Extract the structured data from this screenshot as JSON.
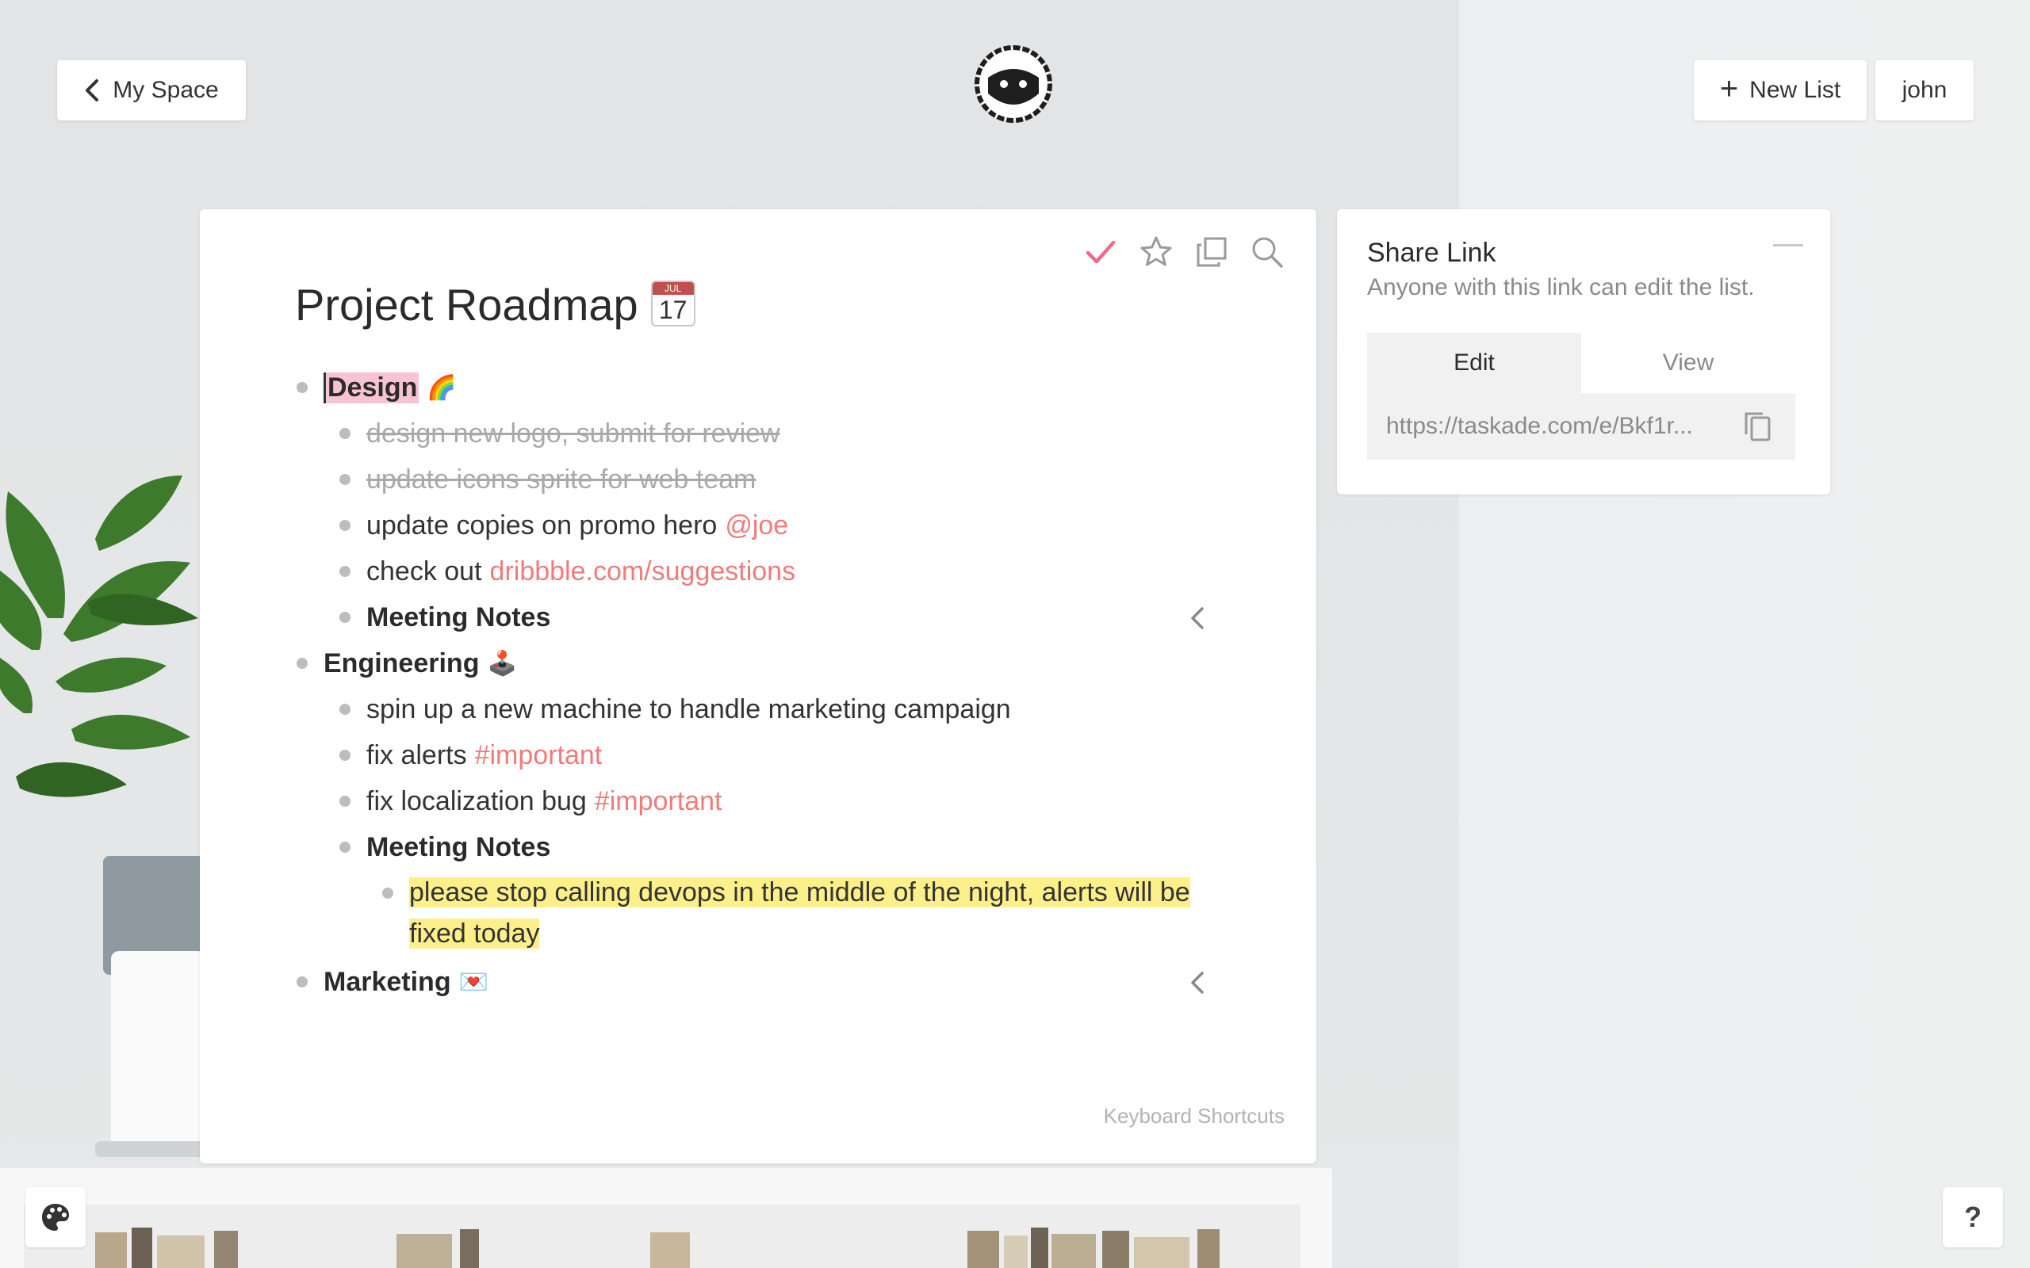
{
  "header": {
    "back_label": "My Space",
    "new_list_label": "New List",
    "user_label": "john"
  },
  "list": {
    "title": "Project Roadmap",
    "calendar_emoji": {
      "month": "JUL",
      "day": "17"
    },
    "items": [
      {
        "text": "Design",
        "emoji": "🌈",
        "level": 0,
        "bold": true,
        "highlight": "pink"
      },
      {
        "text": "design new logo, submit for review",
        "level": 1,
        "done": true
      },
      {
        "text": "update icons sprite for web team",
        "level": 1,
        "done": true
      },
      {
        "text": "update copies on promo hero",
        "accent": "@joe",
        "level": 1
      },
      {
        "text": "check out",
        "accent": "dribbble.com/suggestions",
        "level": 1
      },
      {
        "text": "Meeting Notes",
        "level": 1,
        "bold": true,
        "collapsible": true
      },
      {
        "text": "Engineering",
        "emoji": "🕹️",
        "level": 0,
        "bold": true
      },
      {
        "text": "spin up a new machine to handle marketing campaign",
        "level": 1
      },
      {
        "text": "fix alerts",
        "accent": "#important",
        "level": 1
      },
      {
        "text": "fix localization bug",
        "accent": "#important",
        "level": 1
      },
      {
        "text": "Meeting Notes",
        "level": 1,
        "bold": true
      },
      {
        "text": "please stop calling devops in the middle of the night, alerts will be fixed today",
        "level": 2,
        "highlight": "yellow"
      },
      {
        "text": "Marketing",
        "emoji": "💌",
        "level": 0,
        "bold": true,
        "collapsible": true
      }
    ],
    "keyboard_shortcuts_label": "Keyboard Shortcuts"
  },
  "toolbar_icons": [
    "check-icon",
    "star-icon",
    "duplicate-icon",
    "search-icon"
  ],
  "share": {
    "title": "Share Link",
    "subtitle": "Anyone with this link can edit the list.",
    "tabs": [
      "Edit",
      "View"
    ],
    "active_tab": "Edit",
    "link": "https://taskade.com/e/Bkf1r..."
  },
  "corner": {
    "help_label": "?"
  },
  "colors": {
    "accent": "#f07b7b",
    "check": "#f06a8a",
    "highlight_pink": "#f8c3d3",
    "highlight_yellow": "#fdf08a"
  }
}
